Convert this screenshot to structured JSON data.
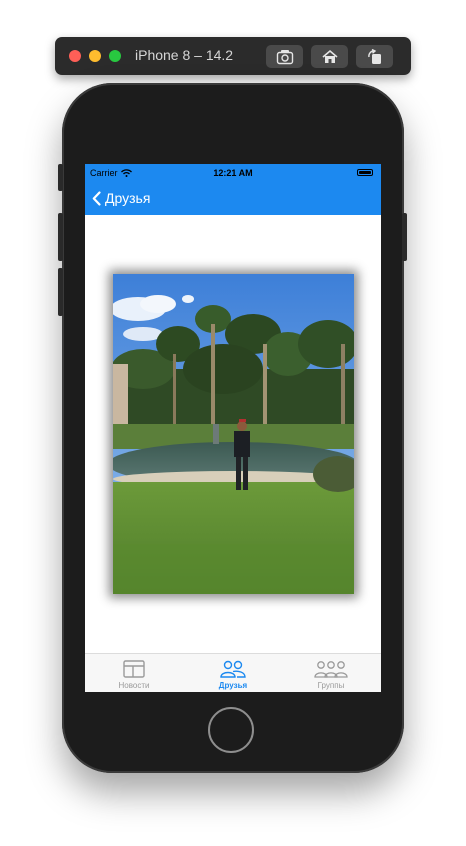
{
  "simulator": {
    "title": "iPhone 8 – 14.2",
    "buttons": [
      "screenshot-icon",
      "home-icon",
      "rotate-icon"
    ]
  },
  "statusbar": {
    "carrier": "Carrier",
    "time": "12:21 AM"
  },
  "navbar": {
    "back_label": "Друзья",
    "color": "#1c89f0"
  },
  "photo": {
    "description_icon": "photo-icon"
  },
  "tabbar": {
    "tabs": [
      {
        "label": "Новости",
        "icon": "news-icon",
        "active": false
      },
      {
        "label": "Друзья",
        "icon": "friends-icon",
        "active": true
      },
      {
        "label": "Группы",
        "icon": "groups-icon",
        "active": false
      }
    ],
    "active_color": "#1c89f0",
    "inactive_color": "#9a9a9a"
  }
}
